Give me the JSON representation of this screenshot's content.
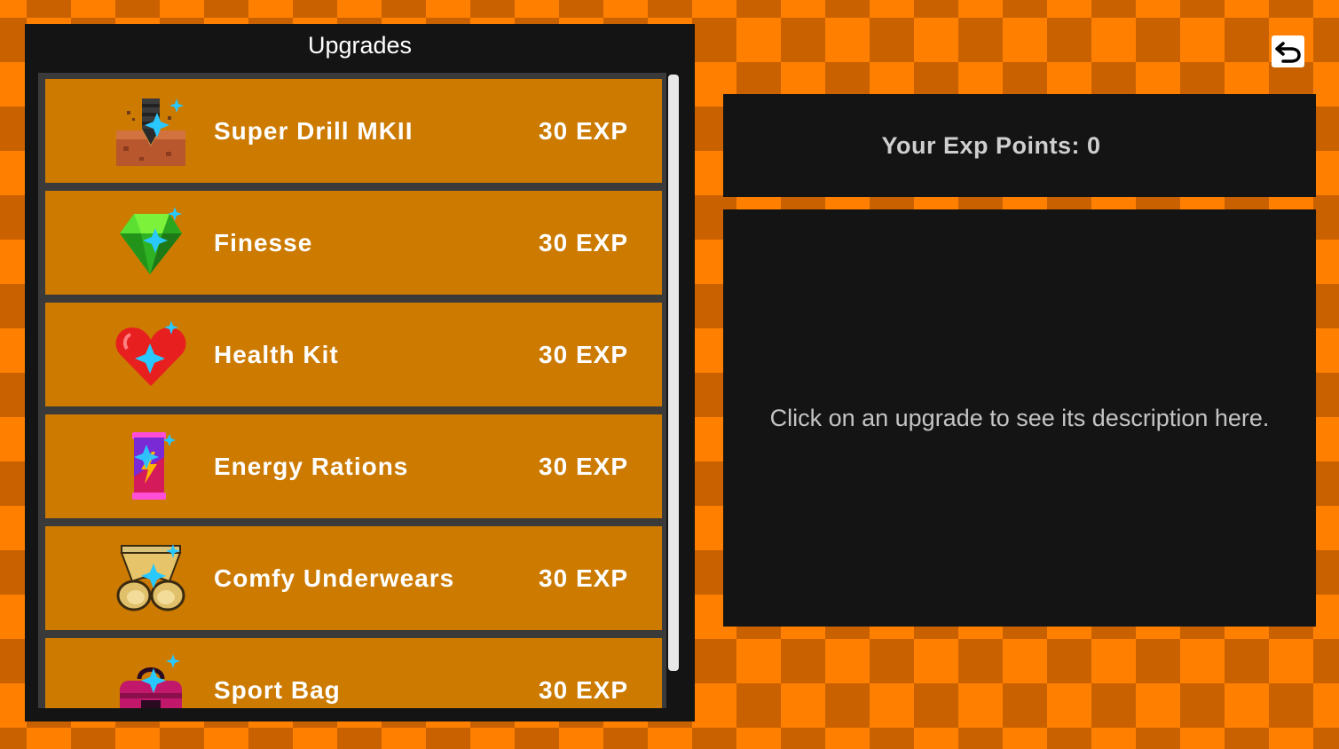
{
  "panel": {
    "title": "Upgrades"
  },
  "upgrades": [
    {
      "name": "Super Drill MKII",
      "cost": "30 EXP",
      "icon": "drill-icon"
    },
    {
      "name": "Finesse",
      "cost": "30 EXP",
      "icon": "gem-icon"
    },
    {
      "name": "Health Kit",
      "cost": "30 EXP",
      "icon": "heart-icon"
    },
    {
      "name": "Energy Rations",
      "cost": "30 EXP",
      "icon": "energy-bar-icon"
    },
    {
      "name": "Comfy Underwears",
      "cost": "30 EXP",
      "icon": "underwear-icon"
    },
    {
      "name": "Sport Bag",
      "cost": "30 EXP",
      "icon": "sport-bag-icon"
    }
  ],
  "exp": {
    "label": "Your Exp Points: 0"
  },
  "description": {
    "placeholder": "Click on an upgrade to see its description here."
  },
  "back_button": {
    "icon": "undo-arrow-icon"
  },
  "colors": {
    "background_orange": "#ff8000",
    "background_dark_orange": "#c96100",
    "panel": "#141414",
    "item": "#cc7a00",
    "sparkle": "#29c8ff"
  }
}
